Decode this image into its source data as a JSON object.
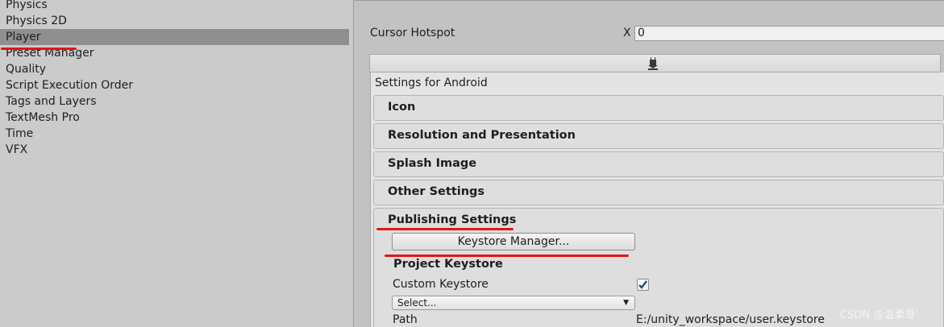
{
  "sidebar": {
    "items": [
      {
        "label": "Physics"
      },
      {
        "label": "Physics 2D"
      },
      {
        "label": "Player"
      },
      {
        "label": "Preset Manager"
      },
      {
        "label": "Quality"
      },
      {
        "label": "Script Execution Order"
      },
      {
        "label": "Tags and Layers"
      },
      {
        "label": "TextMesh Pro"
      },
      {
        "label": "Time"
      },
      {
        "label": "VFX"
      }
    ],
    "selected": "Player"
  },
  "cursor_hotspot": {
    "label": "Cursor Hotspot",
    "x_label": "X",
    "x_value": "0"
  },
  "platform_tab": {
    "icon": "android-icon"
  },
  "settings_header": "Settings for Android",
  "sections": [
    {
      "title": "Icon"
    },
    {
      "title": "Resolution and Presentation"
    },
    {
      "title": "Splash Image"
    },
    {
      "title": "Other Settings"
    }
  ],
  "publishing": {
    "title": "Publishing Settings",
    "keystore_manager_button": "Keystore Manager...",
    "project_keystore_heading": "Project Keystore",
    "custom_keystore_label": "Custom Keystore",
    "custom_keystore_checked": true,
    "select_value": "Select...",
    "path_label": "Path",
    "path_value": "E:/unity_workspace/user.keystore"
  },
  "annotation_color": "#e01616",
  "watermark": "CSDN @温柔哥`"
}
